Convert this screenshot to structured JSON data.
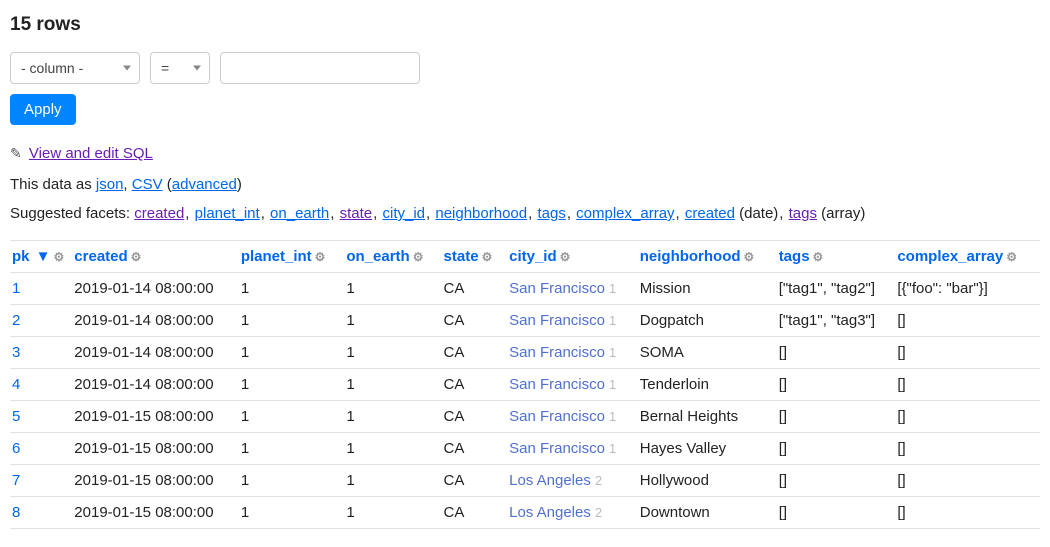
{
  "title": "15 rows",
  "filter": {
    "column_placeholder": "- column -",
    "operator": "=",
    "value": "",
    "apply_label": "Apply"
  },
  "sql": {
    "link_text": "View and edit SQL"
  },
  "export": {
    "prefix": "This data as ",
    "json_label": "json",
    "csv_label": "CSV",
    "advanced_label": "advanced"
  },
  "facets": {
    "prefix": "Suggested facets: ",
    "items": [
      {
        "label": "created",
        "color": "purple"
      },
      {
        "label": "planet_int",
        "color": "blue"
      },
      {
        "label": "on_earth",
        "color": "blue"
      },
      {
        "label": "state",
        "color": "purple"
      },
      {
        "label": "city_id",
        "color": "blue"
      },
      {
        "label": "neighborhood",
        "color": "blue"
      },
      {
        "label": "tags",
        "color": "blue"
      },
      {
        "label": "complex_array",
        "color": "blue"
      }
    ],
    "extra": [
      {
        "label": "created",
        "suffix": " (date)",
        "color": "blue"
      },
      {
        "label": "tags",
        "suffix": " (array)",
        "color": "purple"
      }
    ]
  },
  "columns": [
    {
      "name": "pk",
      "sorted": true
    },
    {
      "name": "created"
    },
    {
      "name": "planet_int"
    },
    {
      "name": "on_earth"
    },
    {
      "name": "state"
    },
    {
      "name": "city_id"
    },
    {
      "name": "neighborhood"
    },
    {
      "name": "tags"
    },
    {
      "name": "complex_array"
    }
  ],
  "rows": [
    {
      "pk": "1",
      "created": "2019-01-14 08:00:00",
      "planet_int": "1",
      "on_earth": "1",
      "state": "CA",
      "city": "San Francisco",
      "city_id": "1",
      "neighborhood": "Mission",
      "tags": "[\"tag1\", \"tag2\"]",
      "complex_array": "[{\"foo\": \"bar\"}]"
    },
    {
      "pk": "2",
      "created": "2019-01-14 08:00:00",
      "planet_int": "1",
      "on_earth": "1",
      "state": "CA",
      "city": "San Francisco",
      "city_id": "1",
      "neighborhood": "Dogpatch",
      "tags": "[\"tag1\", \"tag3\"]",
      "complex_array": "[]"
    },
    {
      "pk": "3",
      "created": "2019-01-14 08:00:00",
      "planet_int": "1",
      "on_earth": "1",
      "state": "CA",
      "city": "San Francisco",
      "city_id": "1",
      "neighborhood": "SOMA",
      "tags": "[]",
      "complex_array": "[]"
    },
    {
      "pk": "4",
      "created": "2019-01-14 08:00:00",
      "planet_int": "1",
      "on_earth": "1",
      "state": "CA",
      "city": "San Francisco",
      "city_id": "1",
      "neighborhood": "Tenderloin",
      "tags": "[]",
      "complex_array": "[]"
    },
    {
      "pk": "5",
      "created": "2019-01-15 08:00:00",
      "planet_int": "1",
      "on_earth": "1",
      "state": "CA",
      "city": "San Francisco",
      "city_id": "1",
      "neighborhood": "Bernal Heights",
      "tags": "[]",
      "complex_array": "[]"
    },
    {
      "pk": "6",
      "created": "2019-01-15 08:00:00",
      "planet_int": "1",
      "on_earth": "1",
      "state": "CA",
      "city": "San Francisco",
      "city_id": "1",
      "neighborhood": "Hayes Valley",
      "tags": "[]",
      "complex_array": "[]"
    },
    {
      "pk": "7",
      "created": "2019-01-15 08:00:00",
      "planet_int": "1",
      "on_earth": "1",
      "state": "CA",
      "city": "Los Angeles",
      "city_id": "2",
      "neighborhood": "Hollywood",
      "tags": "[]",
      "complex_array": "[]"
    },
    {
      "pk": "8",
      "created": "2019-01-15 08:00:00",
      "planet_int": "1",
      "on_earth": "1",
      "state": "CA",
      "city": "Los Angeles",
      "city_id": "2",
      "neighborhood": "Downtown",
      "tags": "[]",
      "complex_array": "[]"
    }
  ]
}
